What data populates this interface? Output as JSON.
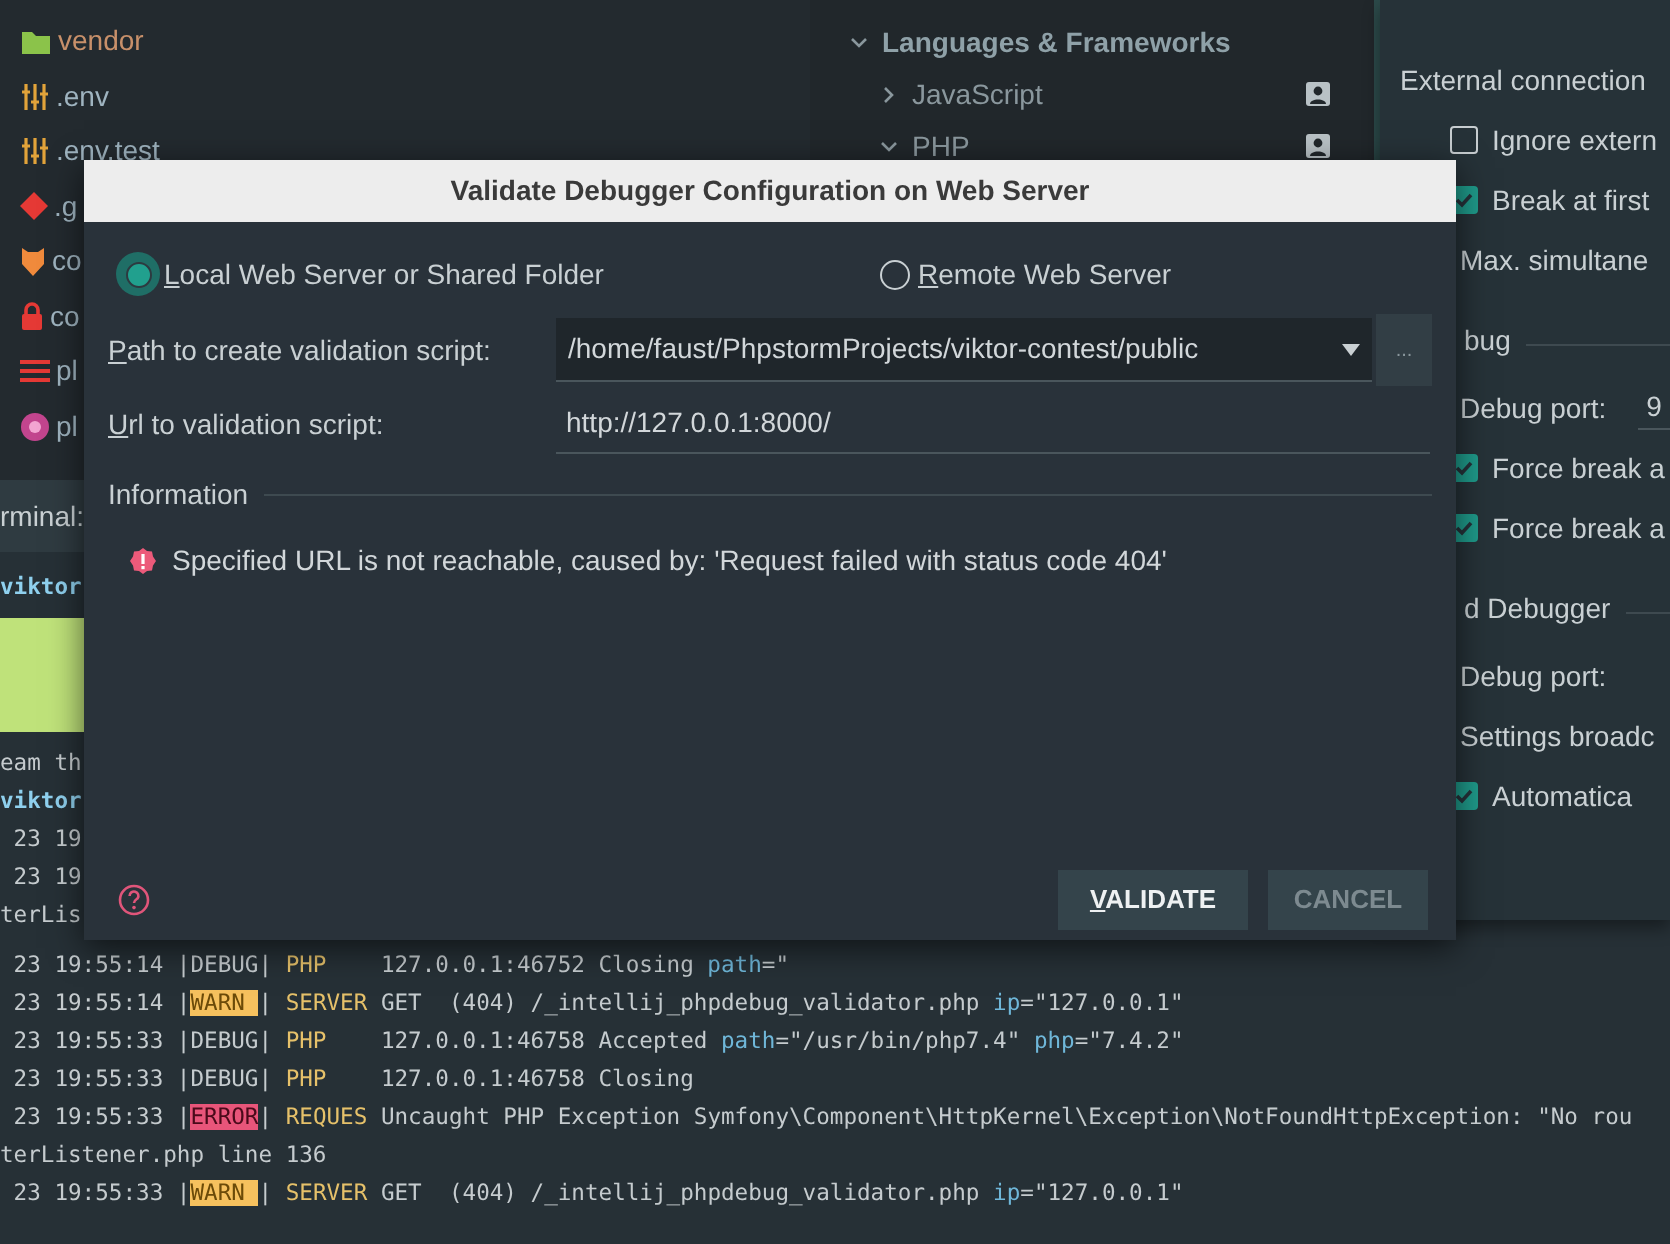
{
  "file_tree": {
    "items": [
      {
        "label": "vendor",
        "kind": "folder"
      },
      {
        "label": ".env",
        "kind": "env"
      },
      {
        "label": ".env.test",
        "kind": "env"
      },
      {
        "label": ".g",
        "kind": "git"
      },
      {
        "label": "co",
        "kind": "composer"
      },
      {
        "label": "co",
        "kind": "lock"
      },
      {
        "label": "pl",
        "kind": "config"
      },
      {
        "label": "pl",
        "kind": "php"
      }
    ]
  },
  "settings_tree": {
    "items": [
      {
        "label": "Languages & Frameworks",
        "expanded": true,
        "children": [
          {
            "label": "JavaScript",
            "expanded": false
          },
          {
            "label": "PHP",
            "expanded": true
          }
        ]
      }
    ]
  },
  "settings_panel": {
    "rows": [
      {
        "kind": "heading",
        "label": "External connection"
      },
      {
        "kind": "checkbox",
        "label": "Ignore extern",
        "checked": false
      },
      {
        "kind": "checkbox",
        "label": "Break at first",
        "checked": true
      },
      {
        "kind": "text",
        "label": "Max. simultane"
      },
      {
        "kind": "section",
        "label": "bug"
      },
      {
        "kind": "field",
        "label": "Debug port:",
        "value": "9"
      },
      {
        "kind": "checkbox",
        "label": "Force break a",
        "checked": true
      },
      {
        "kind": "checkbox",
        "label": "Force break a",
        "checked": true
      },
      {
        "kind": "section",
        "label": "d Debugger"
      },
      {
        "kind": "text",
        "label": "Debug port:"
      },
      {
        "kind": "text",
        "label": "Settings broadc"
      },
      {
        "kind": "checkbox",
        "label": "Automatica",
        "checked": true
      }
    ]
  },
  "terminal": {
    "tab_label": "rminal:",
    "upper_lines": [
      {
        "kind": "prompt",
        "text": "viktor"
      },
      {
        "kind": "banner"
      },
      {
        "kind": "plain",
        "text": "eam th"
      },
      {
        "kind": "prompt",
        "text": "viktor"
      },
      {
        "kind": "plain",
        "text": " 23 19"
      },
      {
        "kind": "plain",
        "text": " 23 19"
      },
      {
        "kind": "plain",
        "text": "terLis"
      }
    ],
    "lines": [
      [
        {
          "kind": "plain",
          "text": " 23 19:55:14 |DEBUG| "
        },
        {
          "kind": "source",
          "text": "PHP"
        },
        {
          "kind": "plain",
          "text": "    127.0.0.1:46752 Closing "
        },
        {
          "kind": "key",
          "text": "path"
        },
        {
          "kind": "plain",
          "text": "=\""
        }
      ],
      [
        {
          "kind": "plain",
          "text": " 23 19:55:14 |"
        },
        {
          "kind": "warn",
          "text": "WARN "
        },
        {
          "kind": "plain",
          "text": "| "
        },
        {
          "kind": "source",
          "text": "SERVER"
        },
        {
          "kind": "plain",
          "text": " GET  (404) /_intellij_phpdebug_validator.php "
        },
        {
          "kind": "key",
          "text": "ip"
        },
        {
          "kind": "plain",
          "text": "=\"127.0.0.1\""
        }
      ],
      [
        {
          "kind": "plain",
          "text": " 23 19:55:33 |DEBUG| "
        },
        {
          "kind": "source",
          "text": "PHP"
        },
        {
          "kind": "plain",
          "text": "    127.0.0.1:46758 Accepted "
        },
        {
          "kind": "key",
          "text": "path"
        },
        {
          "kind": "plain",
          "text": "=\"/usr/bin/php7.4\" "
        },
        {
          "kind": "key",
          "text": "php"
        },
        {
          "kind": "plain",
          "text": "=\"7.4.2\""
        }
      ],
      [
        {
          "kind": "plain",
          "text": " 23 19:55:33 |DEBUG| "
        },
        {
          "kind": "source",
          "text": "PHP"
        },
        {
          "kind": "plain",
          "text": "    127.0.0.1:46758 Closing"
        }
      ],
      [
        {
          "kind": "plain",
          "text": " 23 19:55:33 |"
        },
        {
          "kind": "error",
          "text": "ERROR"
        },
        {
          "kind": "plain",
          "text": "| "
        },
        {
          "kind": "source",
          "text": "REQUES"
        },
        {
          "kind": "plain",
          "text": " Uncaught PHP Exception Symfony\\Component\\HttpKernel\\Exception\\NotFoundHttpException: \"No rou"
        }
      ],
      [
        {
          "kind": "plain",
          "text": "terListener.php line 136"
        }
      ],
      [
        {
          "kind": "plain",
          "text": " 23 19:55:33 |"
        },
        {
          "kind": "warn",
          "text": "WARN "
        },
        {
          "kind": "plain",
          "text": "| "
        },
        {
          "kind": "source",
          "text": "SERVER"
        },
        {
          "kind": "plain",
          "text": " GET  (404) /_intellij_phpdebug_validator.php "
        },
        {
          "kind": "key",
          "text": "ip"
        },
        {
          "kind": "plain",
          "text": "=\"127.0.0.1\""
        }
      ]
    ]
  },
  "dialog": {
    "title": "Validate Debugger Configuration on Web Server",
    "radios": [
      {
        "mnemonic": "L",
        "rest": "ocal Web Server or Shared Folder",
        "selected": true
      },
      {
        "mnemonic": "R",
        "rest": "emote Web Server",
        "selected": false
      }
    ],
    "path_field": {
      "mnemonic": "P",
      "rest": "ath to create validation script:",
      "value": "/home/faust/PhpstormProjects/viktor-contest/public",
      "browse": "..."
    },
    "url_field": {
      "mnemonic": "U",
      "rest": "rl to validation script:",
      "value": "http://127.0.0.1:8000/"
    },
    "information": {
      "title": "Information",
      "message": "Specified URL is not reachable, caused by: 'Request failed with status code 404'"
    },
    "buttons": [
      {
        "mnemonic": "V",
        "rest": "ALIDATE",
        "primary": true
      },
      {
        "rest": "CANCEL",
        "primary": false
      }
    ]
  }
}
